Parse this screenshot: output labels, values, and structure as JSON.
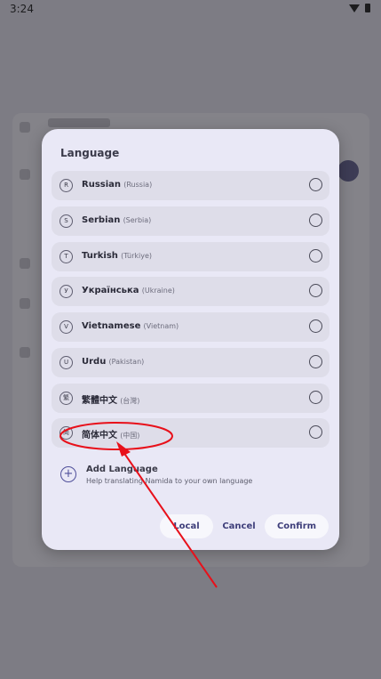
{
  "status_bar": {
    "time": "3:24"
  },
  "dialog": {
    "title": "Language",
    "languages": [
      {
        "badge": "R",
        "name": "Russian",
        "region": "(Russia)"
      },
      {
        "badge": "S",
        "name": "Serbian",
        "region": "(Serbia)"
      },
      {
        "badge": "T",
        "name": "Turkish",
        "region": "(Türkiye)"
      },
      {
        "badge": "У",
        "name": "Українська",
        "region": "(Ukraine)"
      },
      {
        "badge": "V",
        "name": "Vietnamese",
        "region": "(Vietnam)"
      },
      {
        "badge": "U",
        "name": "Urdu",
        "region": "(Pakistan)"
      },
      {
        "badge": "繁",
        "name": "繁體中文",
        "region": "(台灣)"
      },
      {
        "badge": "简",
        "name": "简体中文",
        "region": "(中国)"
      }
    ],
    "add_language": {
      "title": "Add Language",
      "subtitle": "Help translating Namida to your own language"
    },
    "buttons": {
      "local": "Local",
      "cancel": "Cancel",
      "confirm": "Confirm"
    }
  },
  "colors": {
    "accent": "#3e3e7a",
    "annotation": "#e8101a"
  }
}
